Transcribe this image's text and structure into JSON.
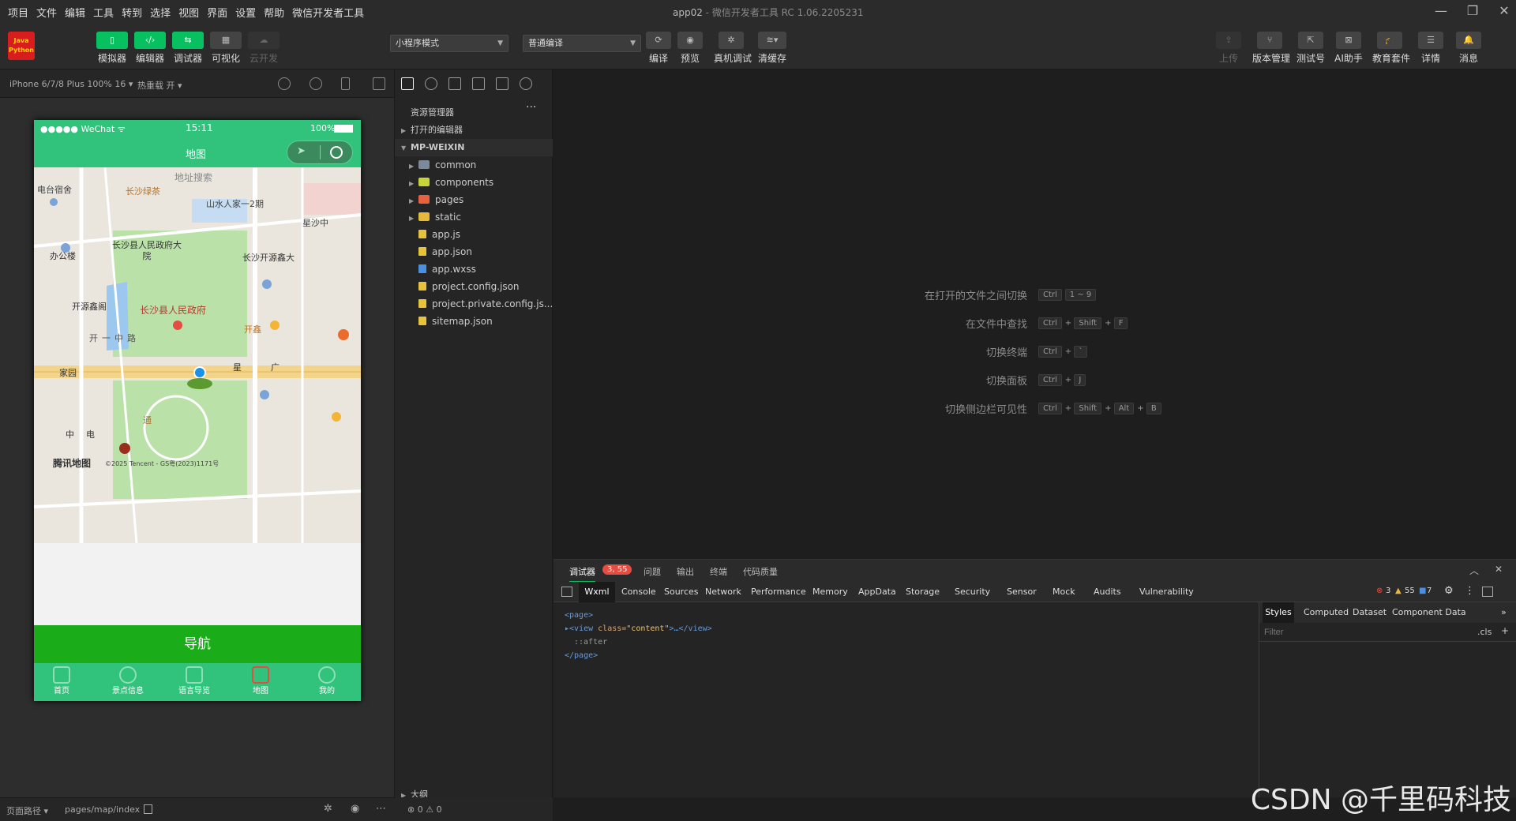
{
  "window": {
    "title": "app02",
    "subtitle": "微信开发者工具 RC 1.06.2205231",
    "menu": [
      "项目",
      "文件",
      "编辑",
      "工具",
      "转到",
      "选择",
      "视图",
      "界面",
      "设置",
      "帮助",
      "微信开发者工具"
    ]
  },
  "toolbar": {
    "logo_text_1": "Java",
    "logo_text_2": "Python",
    "left_buttons": [
      {
        "label": "模拟器",
        "icon": "phone-icon"
      },
      {
        "label": "编辑器",
        "icon": "code-icon"
      },
      {
        "label": "调试器",
        "icon": "debug-icon"
      },
      {
        "label": "可视化",
        "icon": "layout-icon"
      },
      {
        "label": "云开发",
        "icon": "cloud-icon"
      }
    ],
    "mode_select": "小程序模式",
    "compile_select": "普通编译",
    "mid_buttons": [
      {
        "label": "编译",
        "icon": "refresh-icon"
      },
      {
        "label": "预览",
        "icon": "eye-icon"
      },
      {
        "label": "真机调试",
        "icon": "bug-icon"
      },
      {
        "label": "清缓存",
        "icon": "layers-icon"
      }
    ],
    "right_buttons": [
      {
        "label": "上传",
        "icon": "upload-icon"
      },
      {
        "label": "版本管理",
        "icon": "branch-icon"
      },
      {
        "label": "测试号",
        "icon": "external-icon"
      },
      {
        "label": "AI助手",
        "icon": "ai-icon"
      },
      {
        "label": "教育套件",
        "icon": "graduation-icon"
      },
      {
        "label": "详情",
        "icon": "menu-icon"
      },
      {
        "label": "消息",
        "icon": "bell-icon"
      }
    ]
  },
  "simulator": {
    "device": "iPhone 6/7/8 Plus 100% 16 ▾",
    "hotreload": "热重载 开 ▾",
    "status_left": "●●●●● WeChat ᯤ",
    "status_time": "15:11",
    "status_battery": "100%",
    "nav_title": "地图",
    "search_label": "地址搜索",
    "map_labels": [
      "电台宿舍",
      "长沙绿茶",
      "山水人家一2期",
      "星沙中",
      "长沙县人民政府大院",
      "长沙开源鑫大",
      "办公楼",
      "开源鑫阁",
      "长沙县人民政府",
      "开",
      "一",
      "中",
      "路",
      "开鑫",
      "家园",
      "星",
      "广",
      "通",
      "中",
      "电",
      "腾讯地图",
      "©2025 Tencent - GS粤(2023)1171号"
    ],
    "nav_button": "导航",
    "tabs": [
      "首页",
      "景点信息",
      "语言导览",
      "地图",
      "我的"
    ]
  },
  "footer": {
    "page_path_label": "页面路径 ▾",
    "page_path": "pages/map/index",
    "errors": "⊗ 0 ⚠ 0"
  },
  "explorer": {
    "title": "资源管理器",
    "more": "···",
    "open_editors": "打开的编辑器",
    "root": "MP-WEIXIN",
    "items": [
      {
        "name": "common",
        "kind": "folder",
        "color": "#7a8a9c"
      },
      {
        "name": "components",
        "kind": "folder",
        "color": "#c7d33a"
      },
      {
        "name": "pages",
        "kind": "folder",
        "color": "#e8623f"
      },
      {
        "name": "static",
        "kind": "folder",
        "color": "#e5b93b"
      },
      {
        "name": "app.js",
        "kind": "file",
        "color": "#e5c33b"
      },
      {
        "name": "app.json",
        "kind": "file",
        "color": "#e5c33b"
      },
      {
        "name": "app.wxss",
        "kind": "file",
        "color": "#4a90e2"
      },
      {
        "name": "project.config.json",
        "kind": "file",
        "color": "#e5c33b"
      },
      {
        "name": "project.private.config.js...",
        "kind": "file",
        "color": "#e5c33b"
      },
      {
        "name": "sitemap.json",
        "kind": "file",
        "color": "#e5c33b"
      }
    ],
    "outline": "大纲"
  },
  "shortcuts": [
    {
      "label": "在打开的文件之间切换",
      "keys": [
        "Ctrl",
        "1 ~ 9"
      ]
    },
    {
      "label": "在文件中查找",
      "keys": [
        "Ctrl",
        "+",
        "Shift",
        "+",
        "F"
      ]
    },
    {
      "label": "切换终端",
      "keys": [
        "Ctrl",
        "+",
        "`"
      ]
    },
    {
      "label": "切换面板",
      "keys": [
        "Ctrl",
        "+",
        "J"
      ]
    },
    {
      "label": "切换侧边栏可见性",
      "keys": [
        "Ctrl",
        "+",
        "Shift",
        "+",
        "Alt",
        "+",
        "B"
      ]
    }
  ],
  "debug": {
    "tabs": [
      "调试器",
      "问题",
      "输出",
      "终端",
      "代码质量"
    ],
    "badge": "3, 55",
    "panel_tabs": [
      "Wxml",
      "Console",
      "Sources",
      "Network",
      "Performance",
      "Memory",
      "AppData",
      "Storage",
      "Security",
      "Sensor",
      "Mock",
      "Audits",
      "Vulnerability"
    ],
    "err_count": "3",
    "warn_count": "55",
    "info_count": "7",
    "dom": {
      "l1": "<page>",
      "l2_open": "<view ",
      "l2_attr": "class=",
      "l2_val": "\"content\"",
      "l2_close": ">…</view>",
      "l3": "::after",
      "l4": "</page>"
    },
    "right_tabs": [
      "Styles",
      "Computed",
      "Dataset",
      "Component Data"
    ],
    "filter_placeholder": "Filter",
    "cls": ".cls",
    "plus": "+"
  },
  "watermark": "CSDN @千里码科技"
}
